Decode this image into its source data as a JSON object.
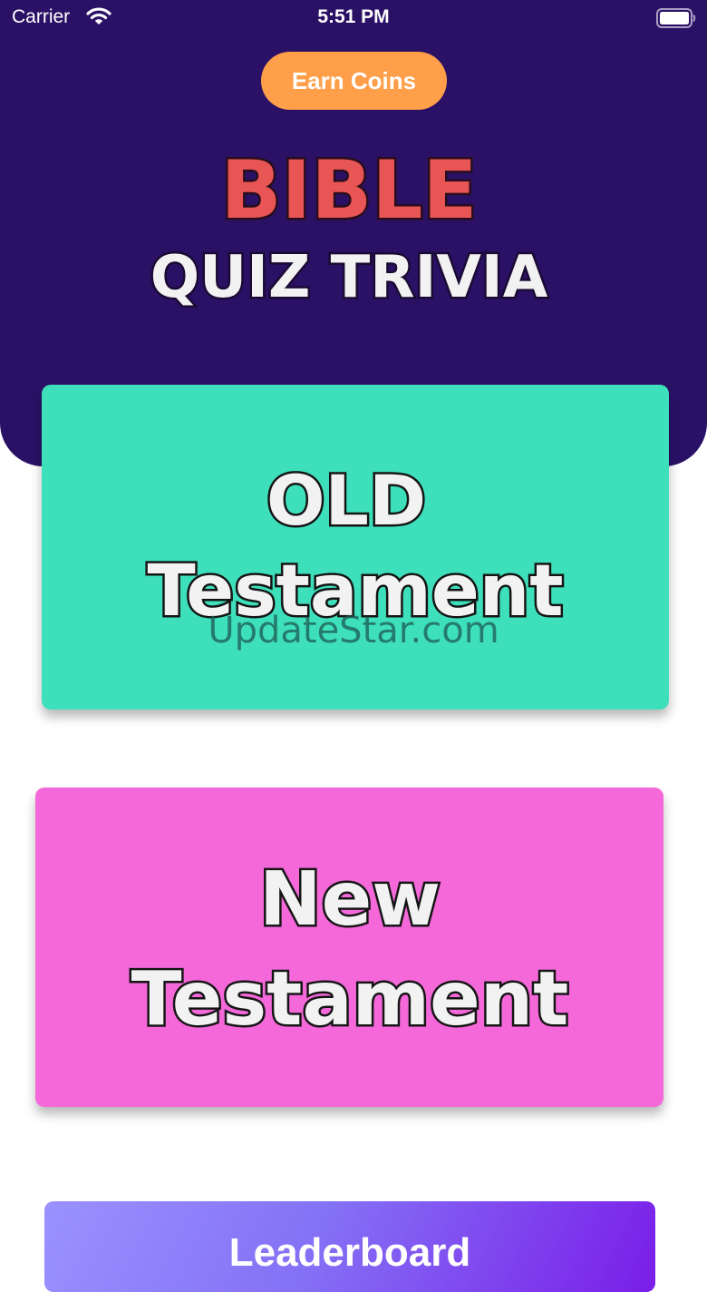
{
  "status_bar": {
    "carrier": "Carrier",
    "time": "5:51 PM"
  },
  "header": {
    "earn_coins_label": "Earn Coins",
    "logo_line1": "BIBLE",
    "logo_line2": "QUIZ TRIVIA"
  },
  "cards": {
    "old": {
      "line1": "OLD",
      "line2": "Testament"
    },
    "new": {
      "line1": "New",
      "line2": "Testament"
    }
  },
  "watermark": "UpdateStar.com",
  "leaderboard_label": "Leaderboard",
  "colors": {
    "header_bg": "#2b1166",
    "earn_coins_bg": "#ff9f4a",
    "old_card_bg": "#3ee0bc",
    "new_card_bg": "#f468d9",
    "logo_red": "#e85555",
    "leaderboard_gradient": [
      "#9a92ff",
      "#7a1de8"
    ]
  }
}
